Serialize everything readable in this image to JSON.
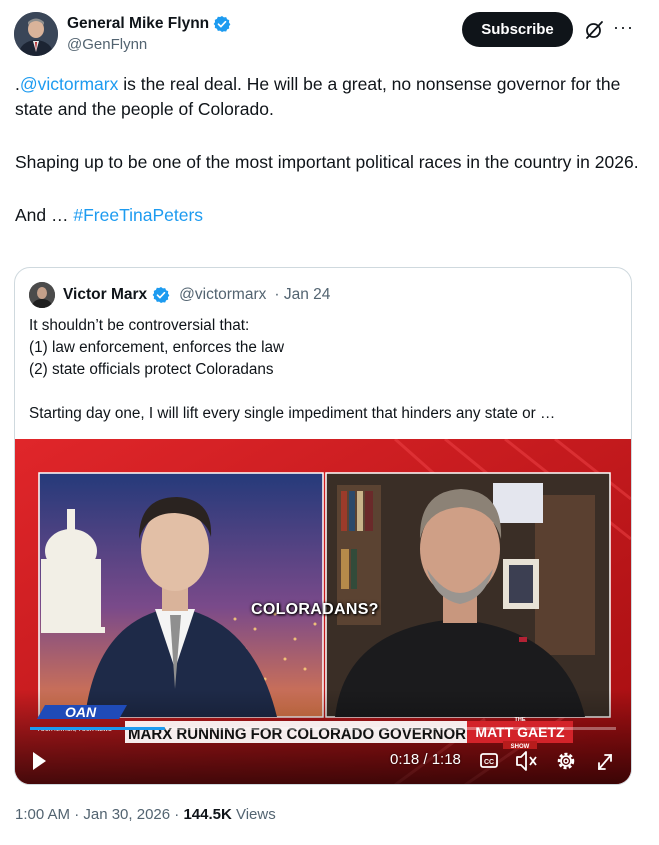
{
  "author": {
    "name": "General Mike Flynn",
    "handle": "@GenFlynn"
  },
  "actions": {
    "subscribe_label": "Subscribe",
    "more_icon": "···"
  },
  "tweet": {
    "line1_prefix": ".",
    "mention": "@victormarx",
    "line1_rest": " is the real deal. He will be a great, no nonsense governor for the state and the people of Colorado.",
    "para2": "Shaping up to be one of the most important political races in the country in 2026.",
    "para3_prefix": "And … ",
    "hashtag": "#FreeTinaPeters"
  },
  "quote": {
    "name": "Victor Marx",
    "handle": "@victormarx",
    "date": "· Jan 24",
    "lines": [
      "It shouldn’t be controversial that:",
      "(1)  law enforcement, enforces the law",
      "(2) state officials protect Coloradans",
      "Starting day one, I will lift every single impediment that hinders any state or …"
    ]
  },
  "video": {
    "caption": "COLORADANS?",
    "network": "OAN",
    "network_tagline": "YOUR NATION, YOUR NEWS",
    "chyron": "MARX RUNNING FOR COLORADO GOVERNOR",
    "show_small": "THE",
    "show_name": "MATT GAETZ",
    "show_tag": "SHOW",
    "time": "0:18 / 1:18",
    "cc_label": "CC",
    "progress": 0.23
  },
  "meta": {
    "time": "1:00 AM · Jan 30, 2026 · ",
    "views_count": "144.5K",
    "views_label": " Views"
  },
  "colors": {
    "accent": "#1d9bf0",
    "text": "#0f1419",
    "muted": "#536471",
    "border": "#cfd9de",
    "video_red": "#c8181b"
  }
}
